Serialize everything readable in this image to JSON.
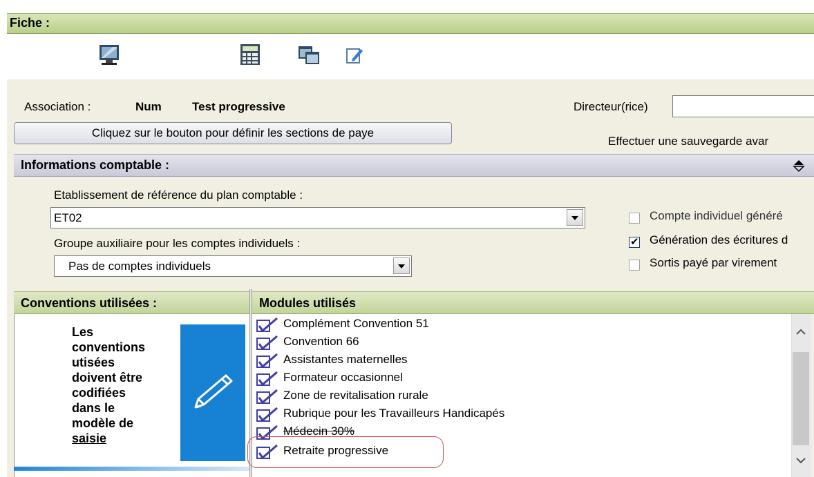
{
  "header": {
    "title": "Fiche :"
  },
  "toolbar": {
    "icons": [
      "monitor-icon",
      "calculator-icon",
      "windows-icon",
      "edit-icon"
    ]
  },
  "association": {
    "label": "Association :",
    "code": "Num",
    "name": "Test progressive"
  },
  "director": {
    "label": "Directeur(rice)",
    "value": ""
  },
  "sections_button": {
    "label": "Cliquez sur le bouton pour définir les sections de paye"
  },
  "save_notice": "Effectuer une sauvegarde avar",
  "accounting": {
    "title": "Informations comptable :",
    "establishment_label": "Etablissement de référence du plan comptable :",
    "establishment_value": "ET02",
    "aux_group_label": "Groupe auxiliaire pour les comptes individuels :",
    "aux_group_value": "Pas de comptes individuels",
    "options": [
      {
        "label": "Compte individuel généré",
        "checked": false
      },
      {
        "label": "Génération des écritures d",
        "checked": true
      },
      {
        "label": "Sortis payé par virement",
        "checked": false
      }
    ]
  },
  "conventions": {
    "title": "Conventions utilisées :",
    "note_lines": [
      "Les",
      "conventions",
      "utisées",
      "doivent être",
      "codifiées",
      "dans le",
      "modèle de",
      "saisie"
    ]
  },
  "modules": {
    "title": "Modules utilisés",
    "items": [
      {
        "label": "Complément Convention 51",
        "checked": true
      },
      {
        "label": "Convention 66",
        "checked": true
      },
      {
        "label": "Assistantes maternelles",
        "checked": true
      },
      {
        "label": "Formateur occasionnel",
        "checked": true
      },
      {
        "label": "Zone de revitalisation rurale",
        "checked": true
      },
      {
        "label": "Rubrique pour les Travailleurs Handicapés",
        "checked": true
      },
      {
        "label": "Médecin 30%",
        "checked": true
      },
      {
        "label": "Retraite progressive",
        "checked": true
      }
    ]
  },
  "colors": {
    "header_green": "#c3d49a",
    "section_lavender": "#c9c9d8",
    "tile_blue": "#1782d4",
    "highlight_red": "#d94a4a"
  }
}
